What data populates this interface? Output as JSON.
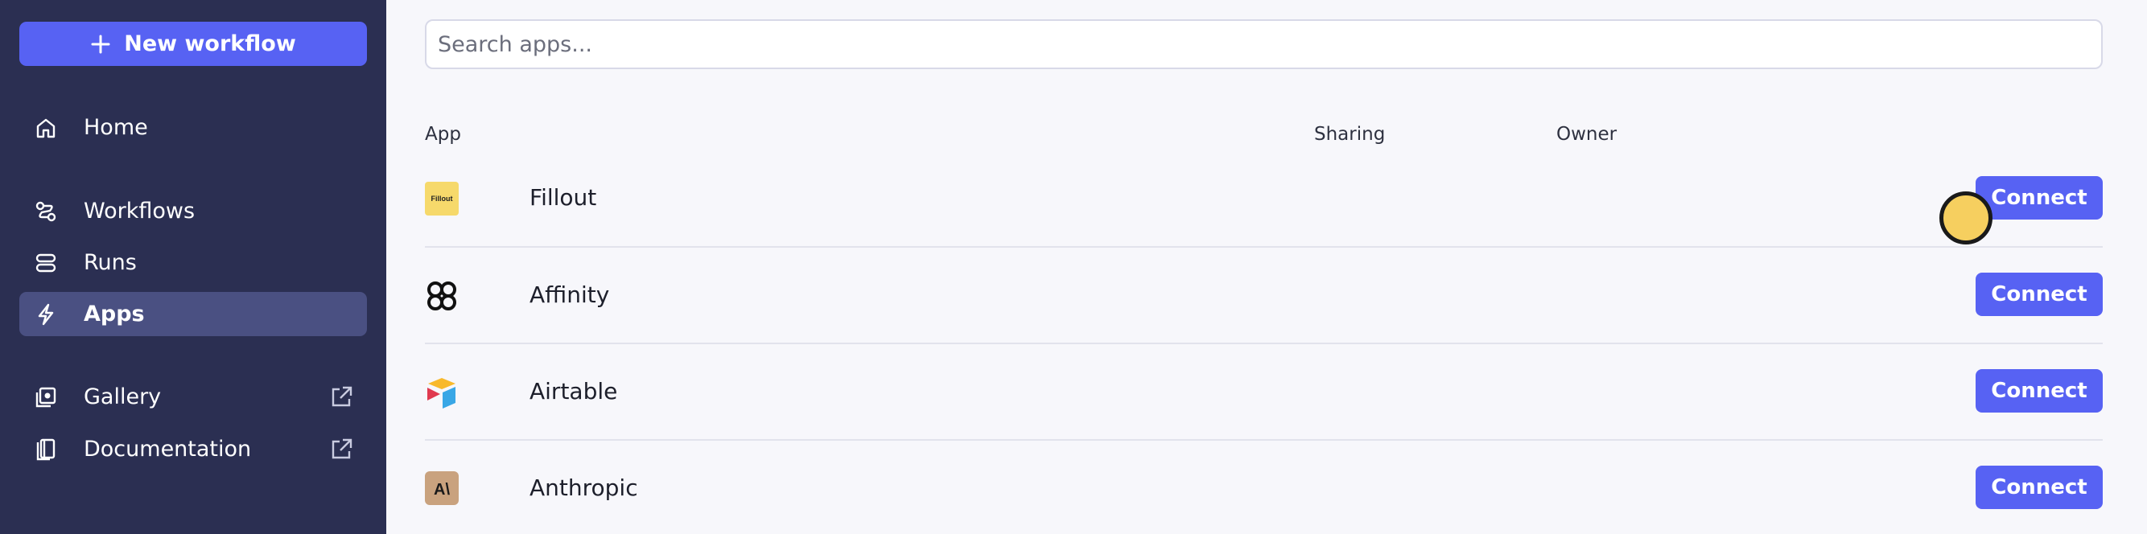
{
  "sidebar": {
    "new_workflow_label": "New workflow",
    "items": [
      {
        "label": "Home",
        "icon": "home-icon"
      },
      {
        "label": "Workflows",
        "icon": "workflows-icon"
      },
      {
        "label": "Runs",
        "icon": "runs-icon"
      },
      {
        "label": "Apps",
        "icon": "bolt-icon",
        "active": true
      },
      {
        "label": "Gallery",
        "icon": "gallery-icon",
        "external": true
      },
      {
        "label": "Documentation",
        "icon": "documentation-icon",
        "external": true
      }
    ]
  },
  "search": {
    "placeholder": "Search apps...",
    "value": ""
  },
  "table": {
    "headers": [
      "App",
      "Sharing",
      "Owner"
    ],
    "rows": [
      {
        "name": "Fillout",
        "icon": "fillout-logo",
        "icon_text": "Fillout",
        "action": "Connect"
      },
      {
        "name": "Affinity",
        "icon": "affinity-logo",
        "action": "Connect"
      },
      {
        "name": "Airtable",
        "icon": "airtable-logo",
        "action": "Connect"
      },
      {
        "name": "Anthropic",
        "icon": "anthropic-logo",
        "icon_text": "A\\",
        "action": "Connect"
      }
    ]
  },
  "colors": {
    "sidebar_bg": "#2b2f52",
    "accent": "#5762f3",
    "active_item_bg": "#4a5082",
    "cursor": "#f6cf5f"
  }
}
